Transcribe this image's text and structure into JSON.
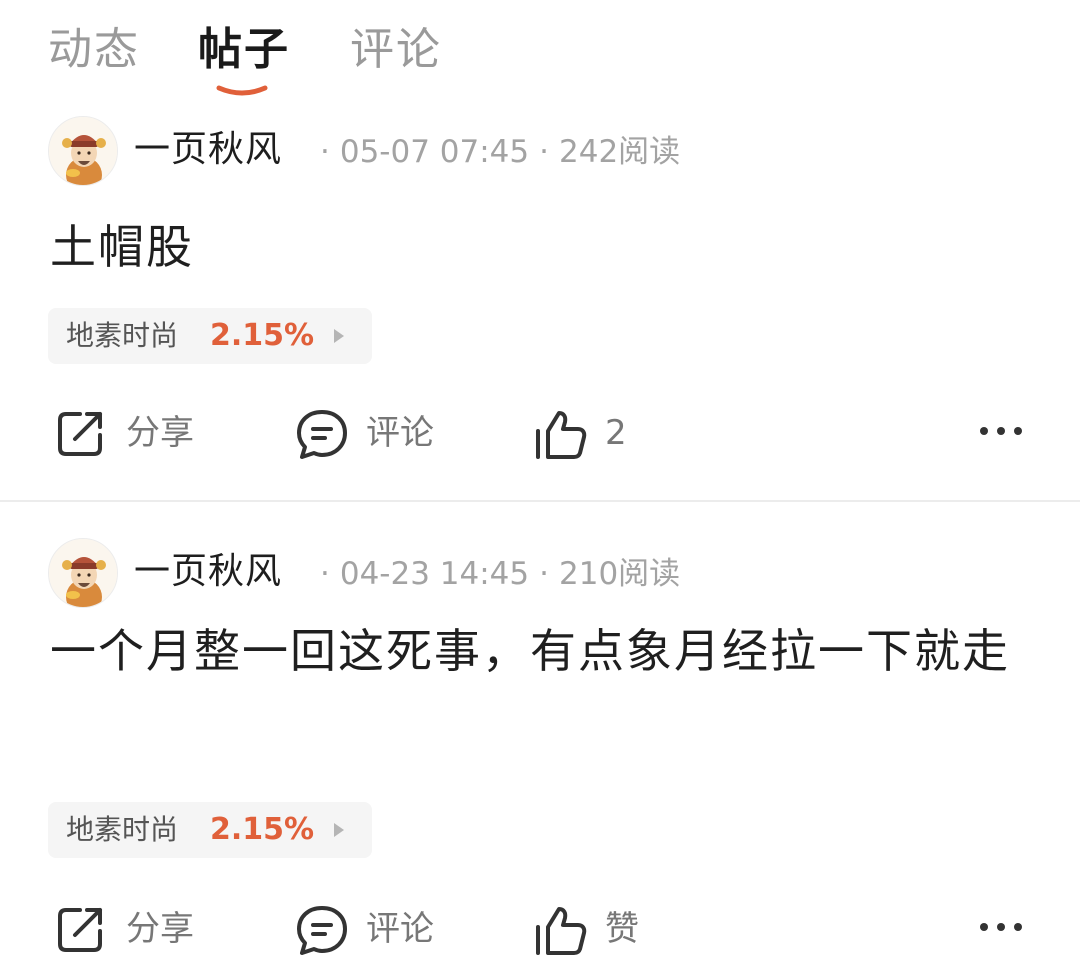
{
  "tabs": [
    {
      "label": "动态",
      "active": false
    },
    {
      "label": "帖子",
      "active": true
    },
    {
      "label": "评论",
      "active": false
    }
  ],
  "accent_color": "#e0603a",
  "posts": [
    {
      "author": "一页秋风",
      "time": "05-07 07:45",
      "reads": "242阅读",
      "text": "土帽股",
      "stock": {
        "name": "地素时尚",
        "change": "2.15%"
      },
      "actions": {
        "share": "分享",
        "comment": "评论",
        "like": "2"
      }
    },
    {
      "author": "一页秋风",
      "time": "04-23 14:45",
      "reads": "210阅读",
      "text": "一个月整一回这死事，有点象月经拉一下就走",
      "stock": {
        "name": "地素时尚",
        "change": "2.15%"
      },
      "actions": {
        "share": "分享",
        "comment": "评论",
        "like": "赞"
      }
    }
  ],
  "icons": {
    "share": "share-icon",
    "comment": "comment-icon",
    "like": "thumbs-up-icon",
    "more": "more-icon",
    "avatar": "caishen-avatar"
  }
}
